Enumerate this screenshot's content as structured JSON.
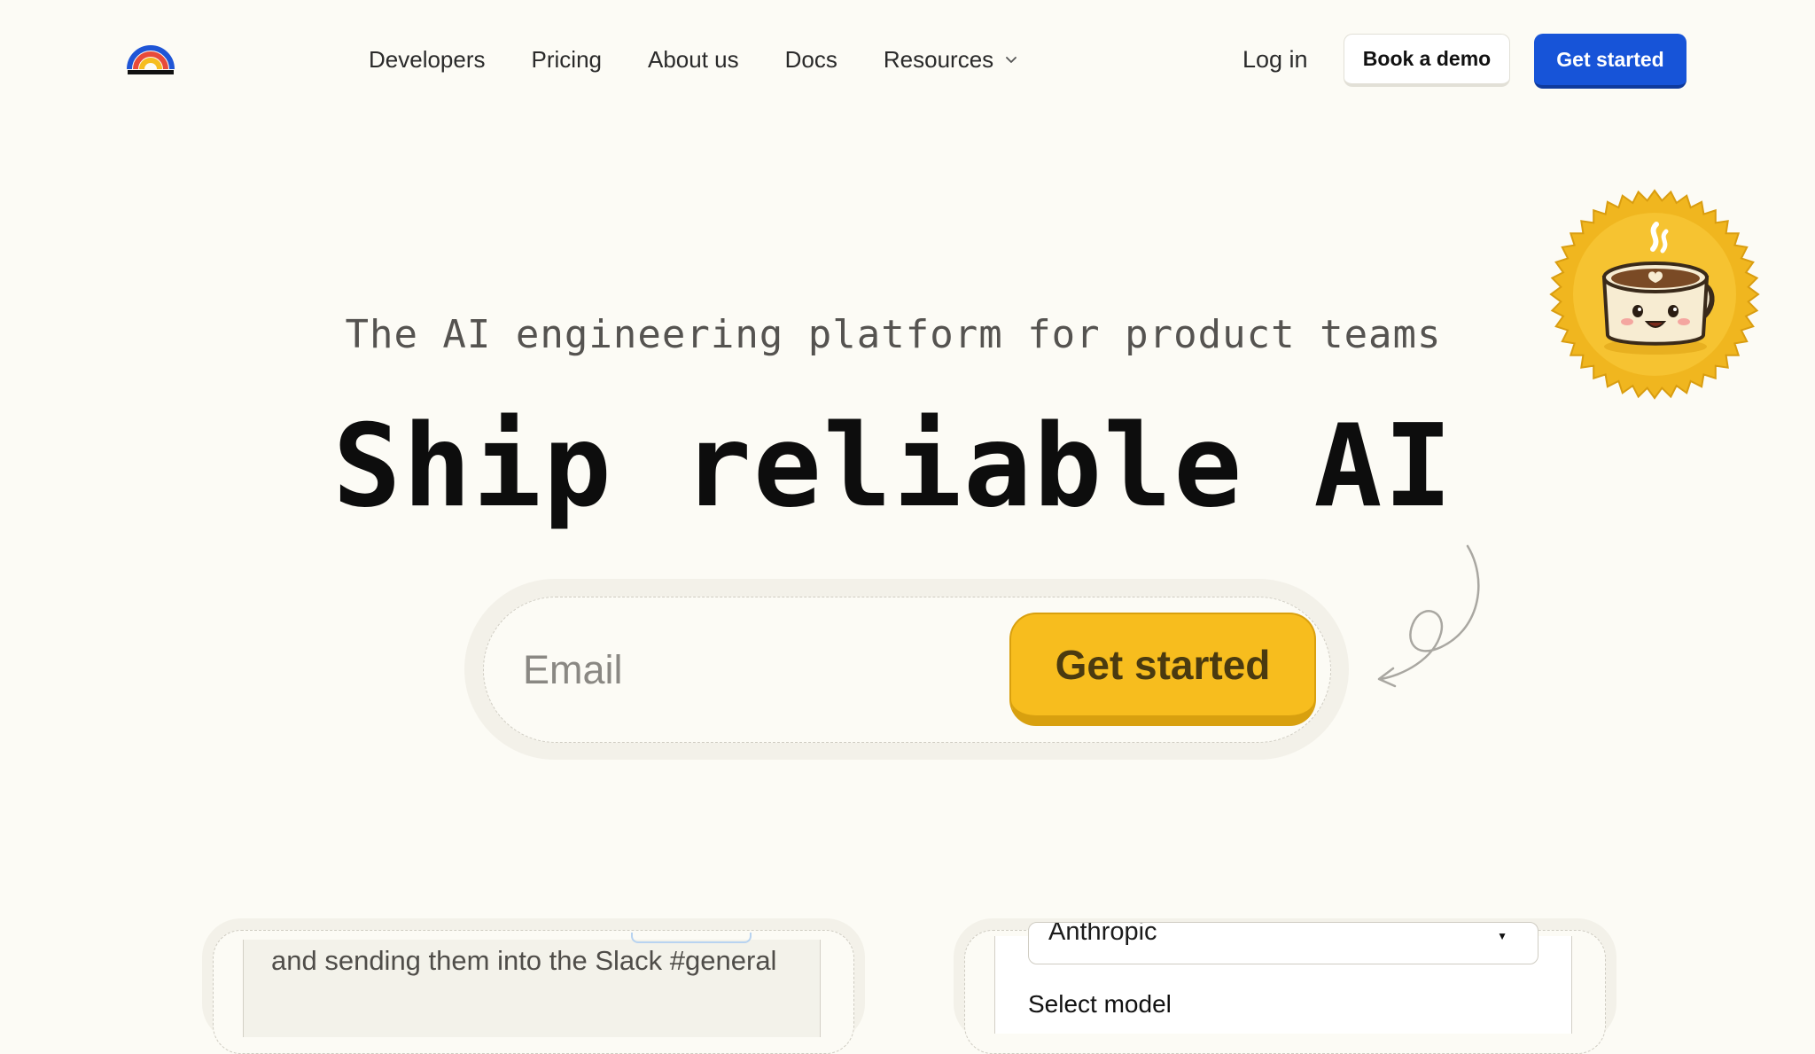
{
  "nav": {
    "items": [
      {
        "label": "Developers"
      },
      {
        "label": "Pricing"
      },
      {
        "label": "About us"
      },
      {
        "label": "Docs"
      },
      {
        "label": "Resources"
      }
    ],
    "login": "Log in",
    "book_demo": "Book a demo",
    "get_started": "Get started"
  },
  "hero": {
    "tagline": "The AI engineering platform for product teams",
    "headline": "Ship reliable AI",
    "email_placeholder": "Email",
    "cta": "Get started"
  },
  "cards": {
    "left_text": "and sending them into the Slack #general",
    "right_select_value": "Anthropic",
    "right_label": "Select model"
  },
  "colors": {
    "background": "#fcfbf5",
    "primary_blue": "#1754d8",
    "cta_yellow": "#f7bd1e",
    "badge_gold": "#f0b61f"
  },
  "icons": [
    "rainbow-logo-icon",
    "chevron-down-icon",
    "coffee-mug-mascot-icon",
    "curved-arrow-icon",
    "caret-down-icon"
  ]
}
